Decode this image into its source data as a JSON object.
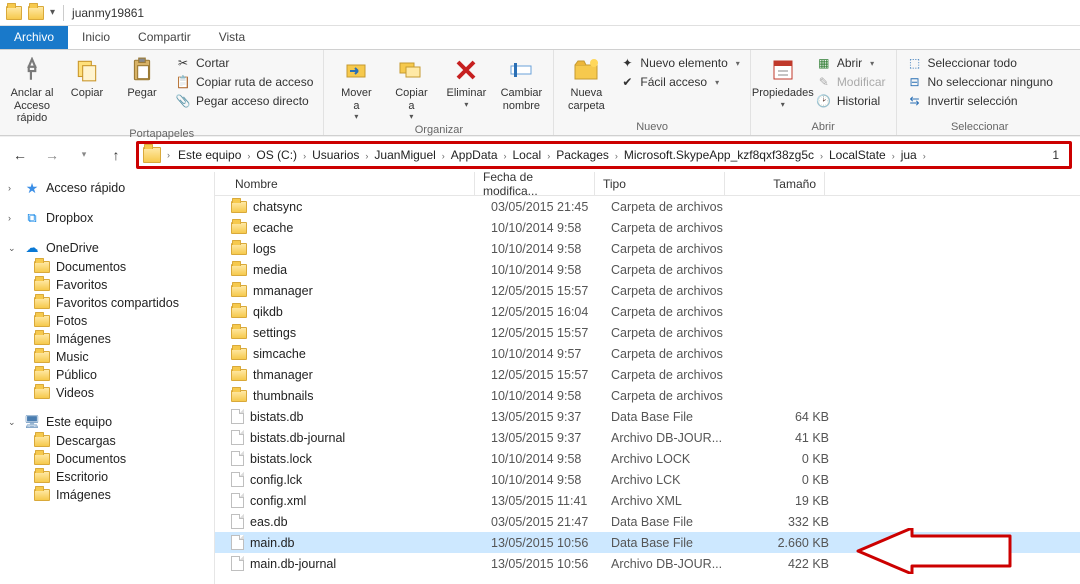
{
  "window": {
    "title": "juanmy19861"
  },
  "tabs": {
    "archivo": "Archivo",
    "inicio": "Inicio",
    "compartir": "Compartir",
    "vista": "Vista"
  },
  "ribbon": {
    "portapapeles": {
      "anclar": "Anclar al\nAcceso rápido",
      "copiar": "Copiar",
      "pegar": "Pegar",
      "cortar": "Cortar",
      "copiar_ruta": "Copiar ruta de acceso",
      "pegar_directo": "Pegar acceso directo",
      "group": "Portapapeles"
    },
    "organizar": {
      "mover": "Mover\na",
      "copiar": "Copiar\na",
      "eliminar": "Eliminar",
      "cambiar_nombre": "Cambiar\nnombre",
      "group": "Organizar"
    },
    "nuevo": {
      "nueva_carpeta": "Nueva\ncarpeta",
      "nuevo_elemento": "Nuevo elemento",
      "facil_acceso": "Fácil acceso",
      "group": "Nuevo"
    },
    "abrir": {
      "propiedades": "Propiedades",
      "abrir": "Abrir",
      "modificar": "Modificar",
      "historial": "Historial",
      "group": "Abrir"
    },
    "seleccionar": {
      "todo": "Seleccionar todo",
      "ninguno": "No seleccionar ninguno",
      "invertir": "Invertir selección",
      "group": "Seleccionar"
    }
  },
  "breadcrumb": {
    "items": [
      "Este equipo",
      "OS (C:)",
      "Usuarios",
      "JuanMiguel",
      "AppData",
      "Local",
      "Packages",
      "Microsoft.SkypeApp_kzf8qxf38zg5c",
      "LocalState",
      "jua"
    ],
    "trailing": "1"
  },
  "columns": {
    "name": "Nombre",
    "date": "Fecha de modifica...",
    "type": "Tipo",
    "size": "Tamaño"
  },
  "sidebar": {
    "quick": {
      "label": "Acceso rápido"
    },
    "dropbox": {
      "label": "Dropbox"
    },
    "onedrive": {
      "label": "OneDrive",
      "items": [
        "Documentos",
        "Favoritos",
        "Favoritos compartidos",
        "Fotos",
        "Imágenes",
        "Music",
        "Público",
        "Videos"
      ]
    },
    "este_equipo": {
      "label": "Este equipo",
      "items": [
        "Descargas",
        "Documentos",
        "Escritorio",
        "Imágenes"
      ]
    }
  },
  "files": [
    {
      "icon": "folder",
      "name": "chatsync",
      "date": "03/05/2015 21:45",
      "type": "Carpeta de archivos",
      "size": ""
    },
    {
      "icon": "folder",
      "name": "ecache",
      "date": "10/10/2014 9:58",
      "type": "Carpeta de archivos",
      "size": ""
    },
    {
      "icon": "folder",
      "name": "logs",
      "date": "10/10/2014 9:58",
      "type": "Carpeta de archivos",
      "size": ""
    },
    {
      "icon": "folder",
      "name": "media",
      "date": "10/10/2014 9:58",
      "type": "Carpeta de archivos",
      "size": ""
    },
    {
      "icon": "folder",
      "name": "mmanager",
      "date": "12/05/2015 15:57",
      "type": "Carpeta de archivos",
      "size": ""
    },
    {
      "icon": "folder",
      "name": "qikdb",
      "date": "12/05/2015 16:04",
      "type": "Carpeta de archivos",
      "size": ""
    },
    {
      "icon": "folder",
      "name": "settings",
      "date": "12/05/2015 15:57",
      "type": "Carpeta de archivos",
      "size": ""
    },
    {
      "icon": "folder",
      "name": "simcache",
      "date": "10/10/2014 9:57",
      "type": "Carpeta de archivos",
      "size": ""
    },
    {
      "icon": "folder",
      "name": "thmanager",
      "date": "12/05/2015 15:57",
      "type": "Carpeta de archivos",
      "size": ""
    },
    {
      "icon": "folder",
      "name": "thumbnails",
      "date": "10/10/2014 9:58",
      "type": "Carpeta de archivos",
      "size": ""
    },
    {
      "icon": "file",
      "name": "bistats.db",
      "date": "13/05/2015 9:37",
      "type": "Data Base File",
      "size": "64 KB"
    },
    {
      "icon": "file",
      "name": "bistats.db-journal",
      "date": "13/05/2015 9:37",
      "type": "Archivo DB-JOUR...",
      "size": "41 KB"
    },
    {
      "icon": "file",
      "name": "bistats.lock",
      "date": "10/10/2014 9:58",
      "type": "Archivo LOCK",
      "size": "0 KB"
    },
    {
      "icon": "file",
      "name": "config.lck",
      "date": "10/10/2014 9:58",
      "type": "Archivo LCK",
      "size": "0 KB"
    },
    {
      "icon": "file",
      "name": "config.xml",
      "date": "13/05/2015 11:41",
      "type": "Archivo XML",
      "size": "19 KB"
    },
    {
      "icon": "file",
      "name": "eas.db",
      "date": "03/05/2015 21:47",
      "type": "Data Base File",
      "size": "332 KB"
    },
    {
      "icon": "file",
      "name": "main.db",
      "date": "13/05/2015 10:56",
      "type": "Data Base File",
      "size": "2.660 KB",
      "selected": true
    },
    {
      "icon": "file",
      "name": "main.db-journal",
      "date": "13/05/2015 10:56",
      "type": "Archivo DB-JOUR...",
      "size": "422 KB"
    }
  ]
}
